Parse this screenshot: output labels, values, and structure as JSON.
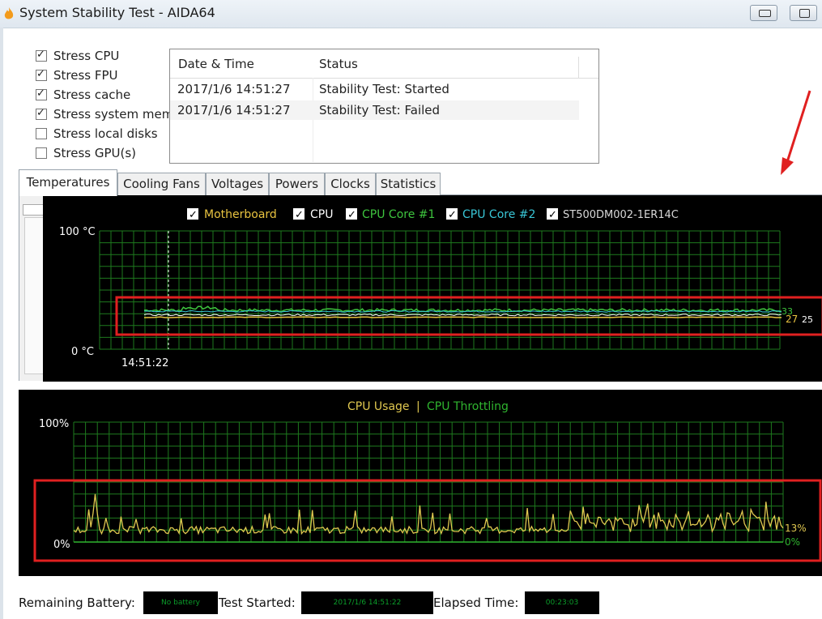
{
  "window": {
    "title": "System Stability Test - AIDA64"
  },
  "stress_options": [
    {
      "label": "Stress CPU",
      "checked": true
    },
    {
      "label": "Stress FPU",
      "checked": true
    },
    {
      "label": "Stress cache",
      "checked": true
    },
    {
      "label": "Stress system mem",
      "checked": true
    },
    {
      "label": "Stress local disks",
      "checked": false
    },
    {
      "label": "Stress GPU(s)",
      "checked": false
    }
  ],
  "log": {
    "headers": [
      "Date & Time",
      "Status"
    ],
    "rows": [
      {
        "datetime": "2017/1/6 14:51:27",
        "status": "Stability Test: Started"
      },
      {
        "datetime": "2017/1/6 14:51:27",
        "status": "Stability Test: Failed"
      }
    ]
  },
  "tabs": [
    "Temperatures",
    "Cooling Fans",
    "Voltages",
    "Powers",
    "Clocks",
    "Statistics"
  ],
  "active_tab": "Temperatures",
  "temperature_graph": {
    "legend": [
      {
        "label": "Motherboard",
        "color": "#e8c340",
        "checked": true
      },
      {
        "label": "CPU",
        "color": "#ffffff",
        "checked": true
      },
      {
        "label": "CPU Core #1",
        "color": "#3ec43e",
        "checked": true
      },
      {
        "label": "CPU Core #2",
        "color": "#39c6d6",
        "checked": true
      },
      {
        "label": "ST500DM002-1ER14C",
        "color": "#d8d8d8",
        "checked": true
      }
    ],
    "y_max_label": "100 °C",
    "y_min_label": "0 °C",
    "time_label": "14:51:22",
    "end_value_top": "33",
    "end_value_main": "27",
    "end_value_sub": "25"
  },
  "cpu_graph": {
    "legend_usage": "CPU Usage",
    "legend_sep": "|",
    "legend_throttling": "CPU Throttling",
    "usage_color": "#e0c850",
    "throttling_color": "#2fb52f",
    "y_max_label": "100%",
    "y_min_label": "0%",
    "usage_value": "13%",
    "throttling_value": "0%"
  },
  "status_bar": {
    "battery_label": "Remaining Battery:",
    "battery_value": "No battery",
    "started_label": "Test Started:",
    "started_value": "2017/1/6 14:51:22",
    "elapsed_label": "Elapsed Time:",
    "elapsed_value": "00:23:03"
  },
  "colors": {
    "grid": "#1e7a1e",
    "annotation_red": "#e02020"
  }
}
